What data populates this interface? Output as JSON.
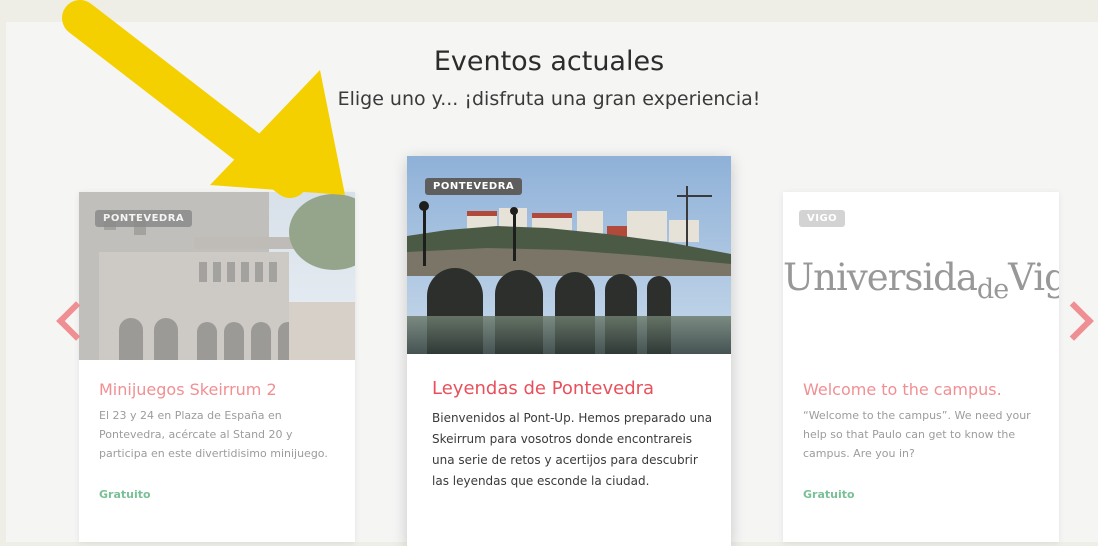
{
  "section": {
    "title": "Eventos actuales",
    "subtitle": "Elige uno y... ¡disfruta una gran experiencia!"
  },
  "cards": [
    {
      "badge": "PONTEVEDRA",
      "title": "Minijuegos Skeirrum 2",
      "description": "El 23 y 24 en Plaza de España en Pontevedra, acércate al Stand 20 y participa en este divertidisimo minijuego.",
      "price": "Gratuito"
    },
    {
      "badge": "PONTEVEDRA",
      "title": "Leyendas de Pontevedra",
      "description": "Bienvenidos al Pont-Up. Hemos preparado una Skeirrum para vosotros donde encontrareis una serie de retos y acertijos para descubrir las leyendas que esconde la ciudad."
    },
    {
      "badge": "VIGO",
      "logo_text": "Universida",
      "logo_text_small": "de",
      "logo_text_end": "Vigo",
      "title": "Welcome to the campus.",
      "description": "“Welcome to the campus”. We need your help so that Paulo can get to know the campus. Are you in?",
      "price": "Gratuito"
    }
  ],
  "colors": {
    "accent_red": "#e8505b",
    "accent_pink": "#f18f93",
    "green": "#3aa06a",
    "annotation_yellow": "#f5d000"
  },
  "icons": {
    "prev": "chevron-left-icon",
    "next": "chevron-right-icon"
  }
}
